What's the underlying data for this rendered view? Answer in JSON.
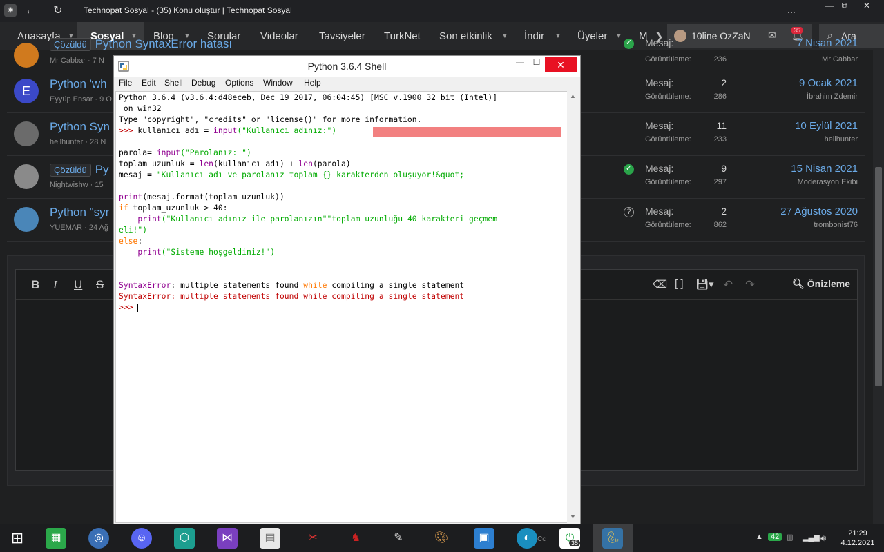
{
  "browser": {
    "window_title": "Technopat Sosyal - (35) Konu oluştur | Technopat Sosyal",
    "more_label": "...",
    "controls": {
      "minimize": "—",
      "restore": "⧉",
      "close": "✕"
    }
  },
  "nav": {
    "items": [
      {
        "label": "Anasayfa",
        "caret": true
      },
      {
        "label": "Sosyal",
        "caret": true,
        "active": true
      },
      {
        "label": "Blog",
        "caret": true
      },
      {
        "label": "Sorular",
        "caret": false
      },
      {
        "label": "Videolar",
        "caret": false
      },
      {
        "label": "Tavsiyeler",
        "caret": false
      },
      {
        "label": "TurkNet",
        "caret": false
      },
      {
        "label": "Son etkinlik",
        "caret": true
      },
      {
        "label": "İndir",
        "caret": true
      },
      {
        "label": "Üyeler",
        "caret": true
      },
      {
        "label": "M",
        "caret": false
      }
    ],
    "username": "10line OzZaN",
    "notification_count": "35",
    "search_label": "Ara"
  },
  "threads": [
    {
      "badge": "Çözüldü",
      "title": "Python SyntaxError hatası",
      "meta": "Mr Cabbar · 7 N",
      "msg_label": "Mesaj:",
      "msg": "",
      "views_label": "Görüntüleme:",
      "views": "236",
      "date": "7 Nisan 2021",
      "user": "Mr Cabbar",
      "status": "solved",
      "avatar_color": "#d07a1e"
    },
    {
      "badge": "",
      "title": "Python 'wh",
      "meta": "Eyyüp Ensar · 9 O",
      "msg_label": "Mesaj:",
      "msg": "2",
      "views_label": "Görüntüleme:",
      "views": "286",
      "date": "9 Ocak 2021",
      "user": "İbrahim Zdemir",
      "status": "",
      "avatar_color": "#3b49c8",
      "avatar_letter": "E"
    },
    {
      "badge": "",
      "title": "Python Syn",
      "meta": "hellhunter · 28 N",
      "msg_label": "Mesaj:",
      "msg": "11",
      "views_label": "Görüntüleme:",
      "views": "233",
      "date": "10 Eylül 2021",
      "user": "hellhunter",
      "status": "",
      "avatar_color": "#6b6b6b"
    },
    {
      "badge": "Çözüldü",
      "title": "Py",
      "meta": "Nightwishw · 15",
      "msg_label": "Mesaj:",
      "msg": "9",
      "views_label": "Görüntüleme:",
      "views": "297",
      "date": "15 Nisan 2021",
      "user": "Moderasyon Ekibi",
      "status": "solved",
      "avatar_color": "#8a8a8a"
    },
    {
      "badge": "",
      "title": "Python \"syr",
      "meta": "YUEMAR · 24 Ağ",
      "msg_label": "Mesaj:",
      "msg": "2",
      "views_label": "Görüntüleme:",
      "views": "862",
      "date": "27 Ağustos 2020",
      "user": "trombonist76",
      "status": "question",
      "avatar_color": "#4a86b8"
    }
  ],
  "editor": {
    "bold": "B",
    "italic": "I",
    "underline": "U",
    "strike": "S",
    "preview_label": "Önizleme"
  },
  "idle": {
    "title": "Python 3.6.4 Shell",
    "menu": [
      "File",
      "Edit",
      "Shell",
      "Debug",
      "Options",
      "Window",
      "Help"
    ],
    "lines": {
      "l1": "Python 3.6.4 (v3.6.4:d48eceb, Dec 19 2017, 06:04:45) [MSC v.1900 32 bit (Intel)]",
      "l2": " on win32",
      "l3": "Type \"copyright\", \"credits\" or \"license()\" for more information.",
      "prompt": ">>>",
      "l4_a": " kullanıcı_adı = ",
      "l4_fn": "input",
      "l4_str": "(\"Kullanıcı adınız:\")",
      "l5_a": "parola= ",
      "l5_fn": "input",
      "l5_str": "(\"Parolanız: \")",
      "l6_a": "toplam_uzunluk = ",
      "l6_fn1": "len",
      "l6_b": "(kullanıcı_adı) + ",
      "l6_fn2": "len",
      "l6_c": "(parola)",
      "l7_a": "mesaj = ",
      "l7_str": "\"Kullanıcı adı ve parolanız toplam {} karakterden oluşuyor!&quot;",
      "l8_fn": "print",
      "l8_a": "(mesaj.format(toplam_uzunluk))",
      "l9_kw": "if",
      "l9_a": " toplam_uzunluk > 40:",
      "l10_fn": "print",
      "l10_str": "(\"Kullanıcı adınız ile parolanızın\"\"toplam uzunluğu 40 karakteri geçmem",
      "l11_str": "eli!\")",
      "l12_kw": "else",
      "l12_a": ":",
      "l13_fn": "print",
      "l13_str": "(\"Sisteme hoşgeldiniz!\")",
      "err1_a": "SyntaxError",
      "err1_b": ": multiple statements found ",
      "err1_kw": "while",
      "err1_c": " compiling a single statement",
      "err2": "SyntaxError: multiple statements found while compiling a single statement"
    }
  },
  "taskbar": {
    "tray_badge": "42",
    "notification_badge": "35",
    "time": "21:29",
    "date": "4.12.2021",
    "hidden_label": "Cc"
  },
  "colors": {
    "accent_link": "#6aa9e6",
    "idle_keyword": "#ff7700",
    "idle_builtin": "#900090",
    "idle_string": "#00aa00",
    "idle_error": "#c00000",
    "highlight": "#f28080"
  }
}
